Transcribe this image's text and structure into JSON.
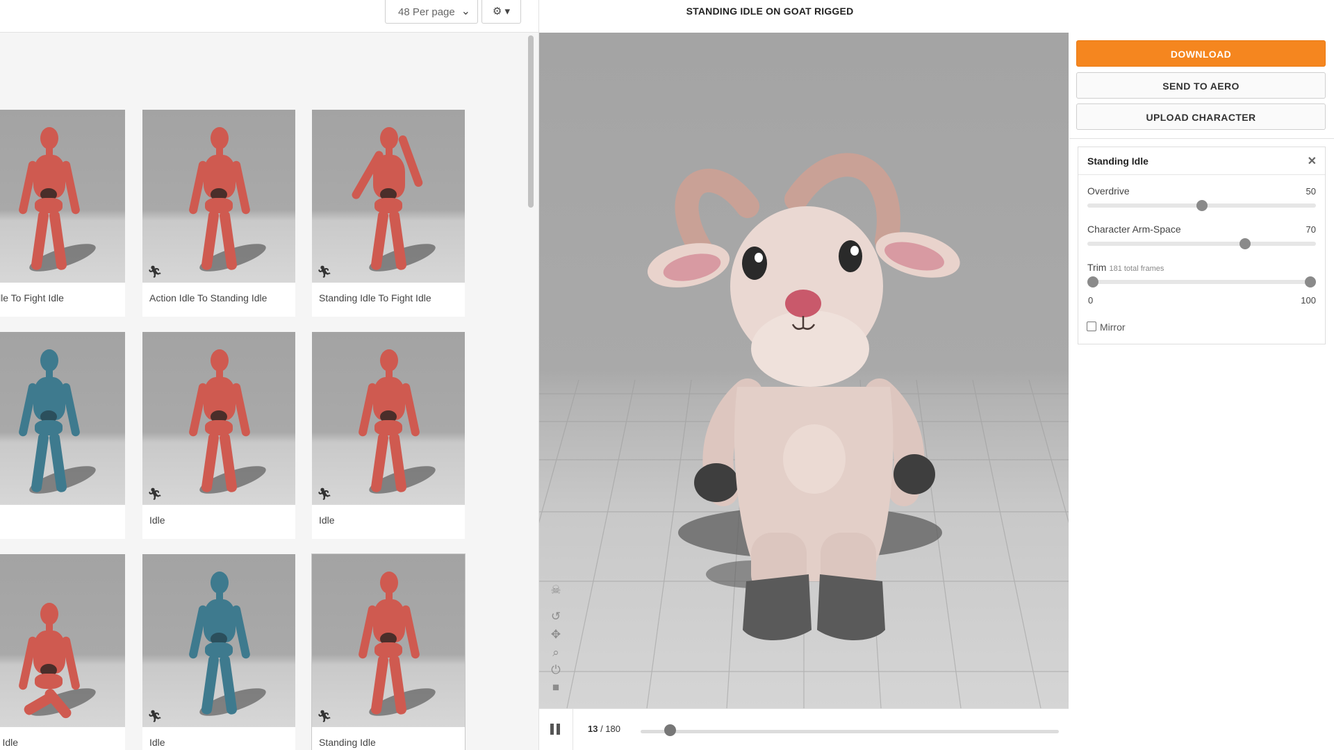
{
  "toolbar": {
    "per_page": "48 Per page",
    "per_page_caret": "⌄",
    "gear": "⚙ ▾"
  },
  "title": "STANDING IDLE ON GOAT RIGGED",
  "grid": {
    "cards": [
      {
        "label": "on Idle To Fight Idle",
        "color": "red",
        "pose": "standing"
      },
      {
        "label": "Action Idle To Standing Idle",
        "color": "red",
        "pose": "standing"
      },
      {
        "label": "Standing Idle To Fight Idle",
        "color": "red",
        "pose": "fight"
      },
      {
        "label": "",
        "color": "blue",
        "pose": "standing"
      },
      {
        "label": "Idle",
        "color": "red",
        "pose": "standing"
      },
      {
        "label": "Idle",
        "color": "red",
        "pose": "standing"
      },
      {
        "label": "eling Idle",
        "color": "red",
        "pose": "kneeling"
      },
      {
        "label": "Idle",
        "color": "blue",
        "pose": "standing"
      },
      {
        "label": "Standing Idle",
        "color": "red",
        "pose": "standing",
        "selected": true
      }
    ]
  },
  "viewport": {
    "icons": [
      "skull-icon",
      "undo-icon",
      "move-icon",
      "zoom-icon",
      "power-icon",
      "camera-icon"
    ]
  },
  "player": {
    "current_frame": "13",
    "frames_sep": " / 180",
    "progress_fraction": 0.07
  },
  "actions": {
    "download": "DOWNLOAD",
    "send": "SEND TO AERO",
    "upload": "UPLOAD CHARACTER"
  },
  "panel": {
    "title": "Standing Idle",
    "close": "✕",
    "overdrive_label": "Overdrive",
    "overdrive_value": "50",
    "overdrive_fraction": 0.5,
    "armspace_label": "Character Arm-Space",
    "armspace_value": "70",
    "armspace_fraction": 0.7,
    "trim_label": "Trim",
    "trim_sub": "181 total frames",
    "trim_min": "0",
    "trim_max": "100",
    "mirror_label": "Mirror",
    "mirror_checked": false
  },
  "colors": {
    "accent": "#f5861f",
    "figure_red": "#cf5a50",
    "figure_blue": "#3e7a8e"
  }
}
